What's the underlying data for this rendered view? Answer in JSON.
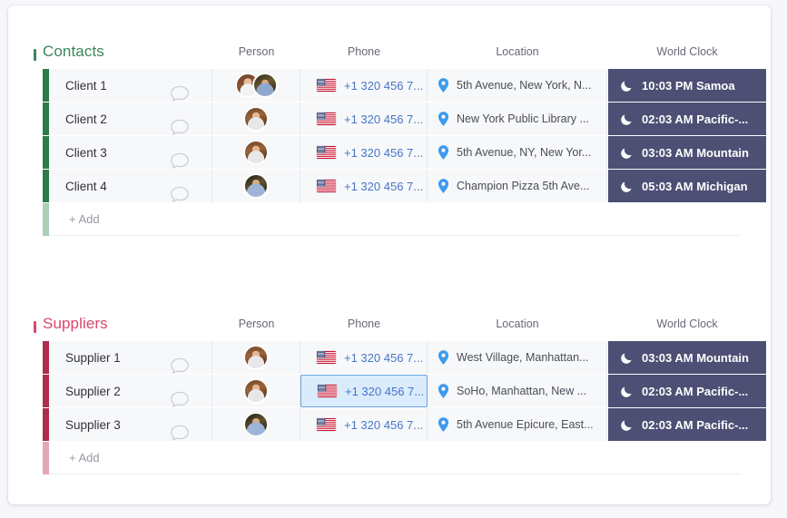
{
  "colors": {
    "contacts_accent": "#3b8659",
    "contacts_bar": "#2d7a4a",
    "contacts_bar_faded": "#a9cfb5",
    "suppliers_accent": "#d9486d",
    "suppliers_bar": "#ab2f4d",
    "suppliers_bar_faded": "#e3a7b6",
    "clock_cell_bg": "#4d4f74",
    "phone_link": "#4676c9",
    "selected_cell_bg": "#daebfb",
    "selected_cell_border": "#6ba4de",
    "row_bg": "#f7f8fa",
    "card_bg": "#ffffff",
    "page_bg": "#f6f7fb"
  },
  "columns": [
    {
      "key": "person",
      "label": "Person"
    },
    {
      "key": "phone",
      "label": "Phone"
    },
    {
      "key": "location",
      "label": "Location"
    },
    {
      "key": "clock",
      "label": "World Clock"
    }
  ],
  "groups": [
    {
      "id": "contacts",
      "title": "Contacts",
      "accent": "#3b8659",
      "add_label": "+ Add",
      "rows": [
        {
          "name": "Client 1",
          "chat_icon": "speech-bubble-icon",
          "avatars": [
            "av-a",
            "av-b"
          ],
          "flag": "us-flag-icon",
          "phone": "+1 320 456 7...",
          "location_icon": "map-pin-icon",
          "location": "5th Avenue, New York, N...",
          "clock_icon": "moon-icon",
          "clock": "10:03 PM Samoa",
          "phone_selected": false
        },
        {
          "name": "Client 2",
          "chat_icon": "speech-bubble-icon",
          "avatars": [
            "av-c"
          ],
          "flag": "us-flag-icon",
          "phone": "+1 320 456 7...",
          "location_icon": "map-pin-icon",
          "location": "New York Public Library ...",
          "clock_icon": "moon-icon",
          "clock": "02:03 AM Pacific-...",
          "phone_selected": false
        },
        {
          "name": "Client 3",
          "chat_icon": "speech-bubble-icon",
          "avatars": [
            "av-c"
          ],
          "flag": "us-flag-icon",
          "phone": "+1 320 456 7...",
          "location_icon": "map-pin-icon",
          "location": "5th Avenue, NY, New Yor...",
          "clock_icon": "moon-icon",
          "clock": "03:03 AM Mountain",
          "phone_selected": false
        },
        {
          "name": "Client 4",
          "chat_icon": "speech-bubble-icon",
          "avatars": [
            "av-d"
          ],
          "flag": "us-flag-icon",
          "phone": "+1 320 456 7...",
          "location_icon": "map-pin-icon",
          "location": "Champion Pizza 5th Ave...",
          "clock_icon": "moon-icon",
          "clock": "05:03 AM Michigan",
          "phone_selected": false
        }
      ]
    },
    {
      "id": "suppliers",
      "title": "Suppliers",
      "accent": "#d9486d",
      "add_label": "+ Add",
      "rows": [
        {
          "name": "Supplier 1",
          "chat_icon": "speech-bubble-icon",
          "avatars": [
            "av-c"
          ],
          "flag": "us-flag-icon",
          "phone": "+1 320 456 7...",
          "location_icon": "map-pin-icon",
          "location": "West Village, Manhattan...",
          "clock_icon": "moon-icon",
          "clock": "03:03 AM Mountain",
          "phone_selected": false
        },
        {
          "name": "Supplier 2",
          "chat_icon": "speech-bubble-icon",
          "avatars": [
            "av-c"
          ],
          "flag": "us-flag-icon",
          "phone": "+1 320 456 7...",
          "location_icon": "map-pin-icon",
          "location": "SoHo, Manhattan, New ...",
          "clock_icon": "moon-icon",
          "clock": "02:03 AM Pacific-...",
          "phone_selected": true
        },
        {
          "name": "Supplier 3",
          "chat_icon": "speech-bubble-icon",
          "avatars": [
            "av-d"
          ],
          "flag": "us-flag-icon",
          "phone": "+1 320 456 7...",
          "location_icon": "map-pin-icon",
          "location": "5th Avenue Epicure, East...",
          "clock_icon": "moon-icon",
          "clock": "02:03 AM Pacific-...",
          "phone_selected": false
        }
      ]
    }
  ]
}
